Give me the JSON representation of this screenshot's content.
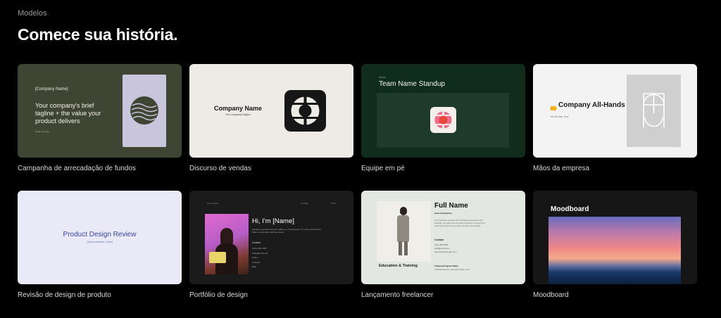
{
  "header": {
    "eyebrow": "Modelos",
    "title": "Comece sua história."
  },
  "cards": [
    {
      "caption": "Campanha de arrecadação de fundos",
      "bg": "#3e4532",
      "company": "[Company Name]",
      "tagline_1": "Your company's brief",
      "tagline_2": "tagline + the value your",
      "tagline_3": "product delivers",
      "footnote": "Vacat Vox logo"
    },
    {
      "caption": "Discurso de vendas",
      "bg": "#eeebe6",
      "company": "Company Name",
      "tagline": "Your company's tagline"
    },
    {
      "caption": "Equipe em pé",
      "bg": "#0f2c1d",
      "eyebrow": "MM/DD",
      "title": "Team Name Standup"
    },
    {
      "caption": "Mãos da empresa",
      "bg": "#f3f3f3",
      "title": "Company All-Hands",
      "date": "Month Day, Year"
    },
    {
      "caption": "Revisão de design de produto",
      "bg": "#e9e9f7",
      "title": "Product Design Review",
      "sub": "[Team members • Date]"
    },
    {
      "caption": "Portfólio de design",
      "bg": "#1b1b1b",
      "nav": [
        "Home Work",
        "Portfolio",
        "2024"
      ],
      "title": "Hi, I'm [Name]",
      "intro_1": "Introduce yourself and your skills in 2–3 sentences. Try to let yourself and",
      "intro_2": "build a connection with the viewer.",
      "contact_label": "Contact",
      "contact": [
        "(123) 456 7890",
        "hello@email.com",
        "Twitter",
        "LinkedIn",
        "Blog"
      ]
    },
    {
      "caption": "Lançamento freelancer",
      "bg": "#e3e7e2",
      "name": "Full Name",
      "area": "Area of Expertise",
      "bio_1": "A 2–3 sentence overview of the freelancer's experience and",
      "bio_2": "expertise. You might note the types of projects or services that",
      "bio_3": "excite them most, and any ways you favour your practice.",
      "contact_label": "Contact",
      "contact": [
        "(123) 456-7890",
        "hello@email.com",
        "www.websitedomain.com"
      ],
      "edu": "Education & Training",
      "program_label": "Training Program Name",
      "program": "Certificate Earned • Associated Skills • Year"
    },
    {
      "caption": "Moodboard",
      "bg": "#161616",
      "title": "Moodboard"
    }
  ],
  "icons": [
    "wave-circle-logo",
    "circle-in-square-logo",
    "pink-circle-app-icon",
    "raised-hands-emoji",
    "arch-window-logo",
    "avatar-photo",
    "profile-photo",
    "sunset-gradient-image"
  ]
}
